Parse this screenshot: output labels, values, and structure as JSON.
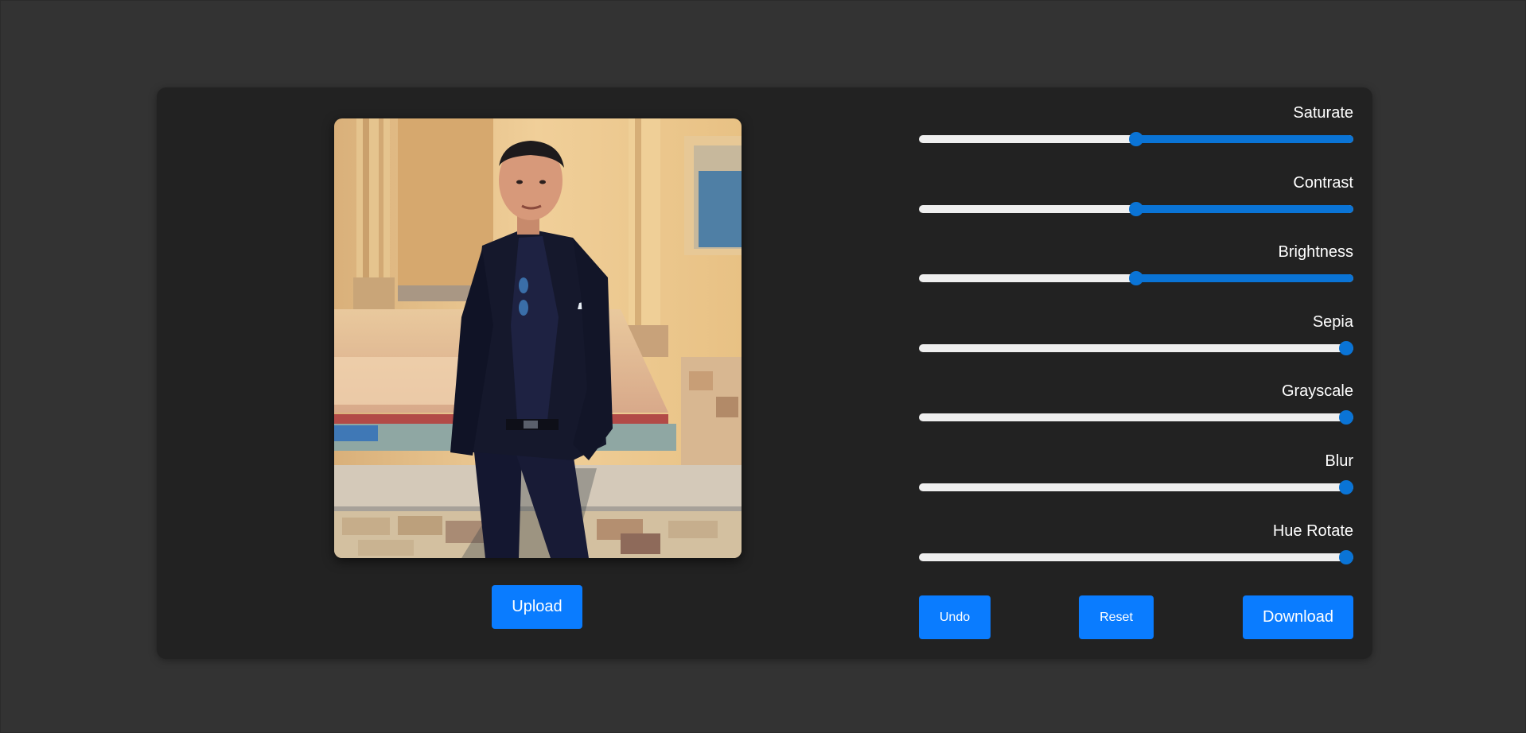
{
  "preview": {
    "upload_label": "Upload"
  },
  "controls": [
    {
      "label": "Saturate",
      "value_fraction": 0.5
    },
    {
      "label": "Contrast",
      "value_fraction": 0.5
    },
    {
      "label": "Brightness",
      "value_fraction": 0.5
    },
    {
      "label": "Sepia",
      "value_fraction": 1.0
    },
    {
      "label": "Grayscale",
      "value_fraction": 1.0
    },
    {
      "label": "Blur",
      "value_fraction": 1.0
    },
    {
      "label": "Hue Rotate",
      "value_fraction": 1.0
    }
  ],
  "actions": {
    "undo_label": "Undo",
    "reset_label": "Reset",
    "download_label": "Download"
  },
  "colors": {
    "accent": "#0a7cff",
    "slider_fill": "#0a74d6",
    "panel_bg": "#222222",
    "page_bg": "#333333"
  }
}
